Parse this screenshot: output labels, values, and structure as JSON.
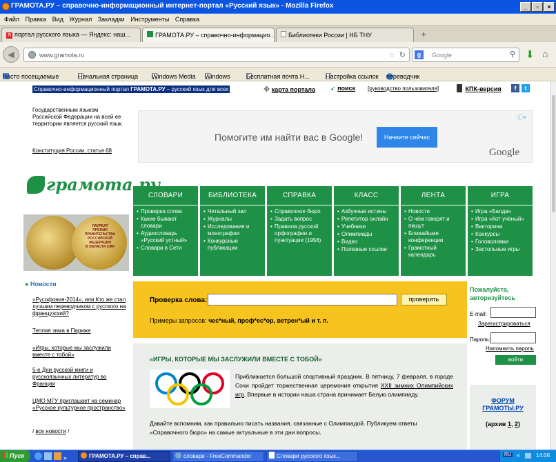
{
  "window": {
    "title": "ГРАМОТА.РУ – справочно-информационный интернет-портал «Русский язык» - Mozilla Firefox"
  },
  "menu": [
    "Файл",
    "Правка",
    "Вид",
    "Журнал",
    "Закладки",
    "Инструменты",
    "Справка"
  ],
  "tabs": [
    {
      "label": "портал русского языка — Яндекс: наш...",
      "active": false
    },
    {
      "label": "ГРАМОТА.РУ – справочно-информацио...",
      "active": true
    },
    {
      "label": "Библиотеки России | НБ ТНУ",
      "active": false
    }
  ],
  "address": {
    "url": "www.gramota.ru",
    "search_placeholder": "Google"
  },
  "bookmarks": [
    "Часто посещаемые",
    "Начальная страница",
    "Windows Media",
    "Windows",
    "Бесплатная почта H...",
    "Настройка ссылок",
    "переводчик"
  ],
  "header": {
    "portal_text_pre": "Справочно-информационный портал ",
    "portal_text_bold": "ГРАМОТА.РУ",
    "portal_text_post": " – русский язык для всех",
    "site_map": "карта портала",
    "search": "поиск",
    "user_guide": "[руководство пользователя]",
    "kpk": "КПК-версия"
  },
  "info": {
    "text": "Государственным языком Российской Федерации на всей ее территории является русский язык.",
    "link": "Конституция России, статья 68"
  },
  "ad": {
    "text": "Помогите им найти вас в Google!",
    "button": "Начните сейчас",
    "brand": "Google"
  },
  "logo": {
    "text": "грамота.ру"
  },
  "medal": {
    "lines": [
      "ЛАУРЕАТ",
      "ПРЕМИИ",
      "ПРАВИТЕЛЬСТВА",
      "РОССИЙСКОЙ",
      "ФЕДЕРАЦИИ",
      "В ОБЛАСТИ СМИ"
    ]
  },
  "nav": [
    {
      "title": "СЛОВАРИ",
      "items": [
        "Проверка слова",
        "Какие бывают словари",
        "Аудиословарь «Русский устный»",
        "Словари в Сети"
      ]
    },
    {
      "title": "БИБЛИОТЕКА",
      "items": [
        "Читальный зал",
        "Журналы",
        "Исследования и монографии",
        "Конкурсные публикации"
      ]
    },
    {
      "title": "СПРАВКА",
      "items": [
        "Справочное бюро",
        "Задать вопрос",
        "Правила русской орфографии и пунктуации (1956)"
      ]
    },
    {
      "title": "КЛАСС",
      "items": [
        "Азбучные истины",
        "Репетитор онлайн",
        "Учебники",
        "Олимпиады",
        "Видео",
        "Полезные ссылки"
      ]
    },
    {
      "title": "ЛЕНТА",
      "items": [
        "Новости",
        "О чём говорят и пишут",
        "Ближайшие конференции",
        "Грамотный календарь"
      ]
    },
    {
      "title": "ИГРА",
      "items": [
        "Игра «Балда»",
        "Игра «Кот учёный»",
        "Викторина",
        "Конкурсы",
        "Головоломки",
        "Застольные игры"
      ]
    }
  ],
  "news": {
    "heading": "Новости",
    "items": [
      "«Русофония-2014», или Кто же стал лучшим переводчиком с русского на французский?",
      "Теплая зима в Париже",
      "«Игры, которые мы заслужили вместе с тобой»",
      "5-е Дни русской книги и русскоязычных литератур во Франции",
      "ЦМО МГУ приглашает на семинар «Русское культурное пространство»"
    ],
    "all_pre": "/ ",
    "all": "все новости",
    "all_post": " /"
  },
  "check": {
    "label": "Проверка слова:",
    "button": "проверить",
    "examples_label": "Примеры запросов: ",
    "examples": "чес*ный, проф*ес*ор, ветрен*ый и т. п."
  },
  "article": {
    "title": "«ИГРЫ, КОТОРЫЕ МЫ ЗАСЛУЖИЛИ ВМЕСТЕ С ТОБОЙ»",
    "p1_pre": "Приближается большой спортивный праздник. В пятницу, 7 февраля, в городе Сочи пройдет торжественная церемония открытия ",
    "p1_link": "XXII зимних Олимпийских игр",
    "p1_post": ". Впервые в истории наша страна принимает Белую олимпиаду.",
    "p2": "Давайте вспомним, как правильно писать названия, связанные с Олимпиадой. Публикуем ответы «Справочного бюро» на самые актуальные в эти дни вопросы."
  },
  "login": {
    "heading": "Пожалуйста, авторизуйтесь",
    "email_label": "E-mail:",
    "register": "Зарегистрироваться",
    "password_label": "Пароль:",
    "remind": "Напомнить пароль",
    "submit": "войти"
  },
  "forum": {
    "title": "ФОРУМ ГРАМОТЫ.РУ",
    "archive_pre": "(архив ",
    "link1": "1",
    "sep": ", ",
    "link2": "2",
    "archive_post": ")"
  },
  "taskbar": {
    "start": "Пуск",
    "windows": [
      "ГРАМОТА.РУ – справ...",
      "словари - FreeCommander",
      "Словари русского язык..."
    ],
    "lang": "RU",
    "clock": "14:06"
  },
  "colors": {
    "green": "#1f9147",
    "yellow": "#f7c41f",
    "titlebar": "#0a54e0",
    "taskbar": "#2657d1",
    "link_blue": "#0044aa"
  }
}
